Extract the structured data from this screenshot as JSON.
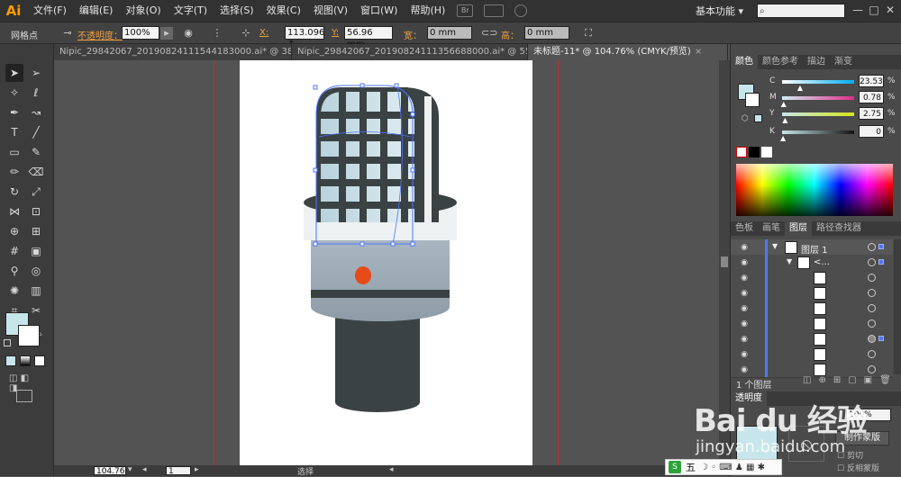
{
  "app": {
    "logo": "Ai"
  },
  "menu": [
    "文件(F)",
    "编辑(E)",
    "对象(O)",
    "文字(T)",
    "选择(S)",
    "效果(C)",
    "视图(V)",
    "窗口(W)",
    "帮助(H)"
  ],
  "menubar_extra": {
    "br_label": "Br",
    "workspace": "基本功能",
    "workspace_arrow": "▾",
    "search_icon": "⌕"
  },
  "window_buttons": {
    "minimize": "—",
    "maximize": "□",
    "close": "✕"
  },
  "control_bar": {
    "selection_type": "网格点",
    "opacity_label": "不透明度：",
    "opacity_value": "100%",
    "x_label": "X:",
    "x_value": "113.096 ↕",
    "y_label": "Y:",
    "y_value": "56.96 mm",
    "w_label": "宽：",
    "w_value": "0 mm",
    "h_label": "高：",
    "h_value": "0 mm"
  },
  "tabs": [
    {
      "label": "Nipic_29842067_20190824111544183000.ai* @ 38...",
      "close": "×",
      "active": false
    },
    {
      "label": "Nipic_29842067_20190824111356688000.ai* @ 55...",
      "close": "×",
      "active": false
    },
    {
      "label": "未标题-11* @ 104.76% (CMYK/预览)",
      "close": "×",
      "active": true
    }
  ],
  "color_panel": {
    "tabs": [
      "颜色",
      "颜色参考",
      "描边",
      "渐变"
    ],
    "active_tab": "颜色",
    "fill_color": "#c7e6ec",
    "sliders": [
      {
        "letter": "C",
        "value": "23.53",
        "fraction": 0.2353
      },
      {
        "letter": "M",
        "value": "0.78",
        "fraction": 0.0078
      },
      {
        "letter": "Y",
        "value": "2.75",
        "fraction": 0.0275
      },
      {
        "letter": "K",
        "value": "0",
        "fraction": 0.0
      }
    ],
    "unit": "%"
  },
  "layers_panel": {
    "tabs": [
      "色板",
      "画笔",
      "图层",
      "路径查找器"
    ],
    "active_tab": "图层",
    "rows": [
      {
        "name": "图层 1",
        "expand": "▼",
        "type": "layer"
      },
      {
        "name": "<...",
        "expand": "▼",
        "type": "group"
      },
      {
        "name": "",
        "type": "path"
      },
      {
        "name": "",
        "type": "path"
      },
      {
        "name": "",
        "type": "path"
      },
      {
        "name": "",
        "type": "path"
      },
      {
        "name": "",
        "type": "path",
        "selected": true
      },
      {
        "name": "",
        "type": "path"
      },
      {
        "name": "",
        "type": "path"
      }
    ],
    "footer": "1 个图层"
  },
  "bottom_panel": {
    "tab": "透明度",
    "opacity": "100%",
    "make_mask": "制作蒙版",
    "clip": "剪切",
    "invert_mask": "反相蒙版"
  },
  "status_bar": {
    "zoom": "104.76",
    "page": "1",
    "tool": "选择"
  },
  "ime": {
    "label": "五"
  },
  "watermark": {
    "brand": "Bai du 经验",
    "url": "jingyan.baidu.com"
  },
  "art_colors": {
    "grille": "#c9dfe6",
    "dark": "#3a4244",
    "band": "#9eabb5",
    "led": "#e64a19",
    "collar": "#eef1f2"
  }
}
